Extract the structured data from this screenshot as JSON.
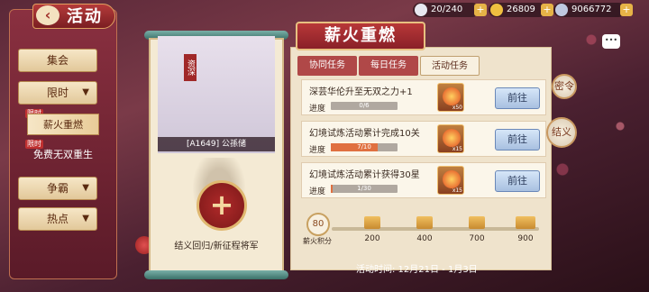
{
  "resources": [
    {
      "icon": "stamina-icon",
      "value": "20/240"
    },
    {
      "icon": "gold-icon",
      "value": "26809"
    },
    {
      "icon": "silver-icon",
      "value": "9066772"
    }
  ],
  "header": {
    "title": "活动"
  },
  "sidebar": {
    "items": [
      {
        "label": "集会"
      },
      {
        "label": "限时"
      },
      {
        "label": "争霸"
      },
      {
        "label": "热点"
      }
    ],
    "sub_items": [
      {
        "label": "薪火重燃",
        "badge": "限时"
      },
      {
        "label": "免费无双重生",
        "badge": "限时"
      }
    ]
  },
  "character": {
    "name": "[A1649] 公孫储",
    "tag": "资深"
  },
  "scroll_caption": "结义回归/新征程将军",
  "main": {
    "title": "薪火重燃",
    "tabs": [
      {
        "label": "协同任务"
      },
      {
        "label": "每日任务"
      },
      {
        "label": "活动任务"
      }
    ],
    "progress_label": "进度",
    "tasks": [
      {
        "title": "深芸华伦升至无双之力+1",
        "progress_text": "0/6",
        "progress": 0.0,
        "reward_count": "x50",
        "button": "前往"
      },
      {
        "title": "幻境试炼活动累计完成10关",
        "progress_text": "7/10",
        "progress": 0.7,
        "reward_count": "x15",
        "button": "前往"
      },
      {
        "title": "幻境试炼活动累计获得30星",
        "progress_text": "1/30",
        "progress": 0.03,
        "reward_count": "x15",
        "button": "前往"
      }
    ],
    "points": {
      "value": "80",
      "label": "薪火积分",
      "milestones": [
        "200",
        "400",
        "700",
        "900"
      ]
    },
    "time": "活动时间: 12月21日 - 1月3日"
  },
  "side_icons": [
    {
      "label": "密令"
    },
    {
      "label": "结义"
    }
  ],
  "colors": {
    "accent": "#b53a3a",
    "progress": "#e07040",
    "button": "#a8c0e0"
  }
}
